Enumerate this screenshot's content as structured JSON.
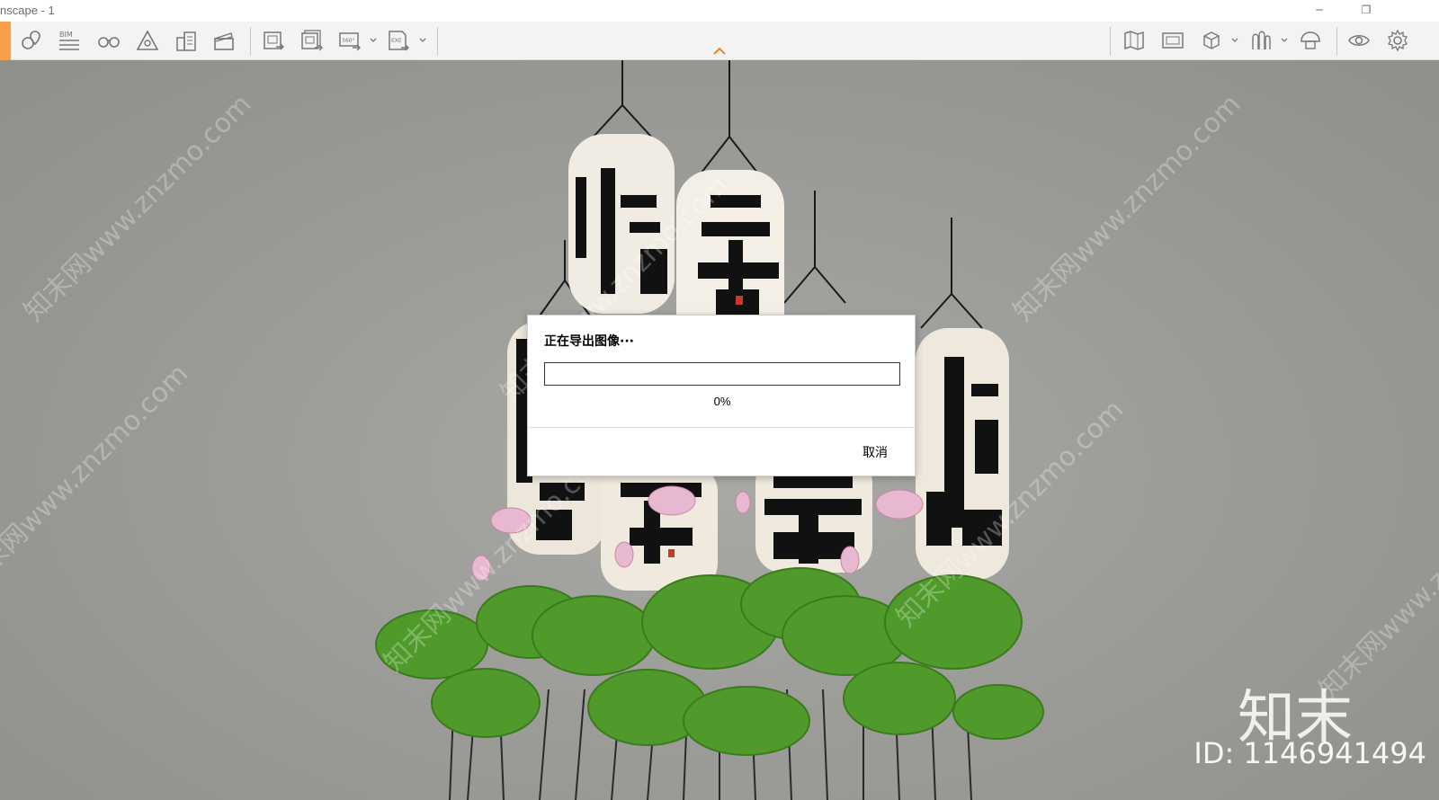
{
  "window": {
    "title": "nscape - 1",
    "minimize_glyph": "─",
    "restore_glyph": "❐"
  },
  "toolbar": {
    "left_icons": [
      "pin-location-icon",
      "bim-list-icon",
      "binoculars-icon",
      "perspective-icon",
      "buildings-icon",
      "clapperboard-icon",
      "export-image-icon",
      "export-batch-image-icon",
      "export-360-icon",
      "export-exe-icon"
    ],
    "right_icons": [
      "map-icon",
      "image-panel-icon",
      "cube-icon",
      "trees-icon",
      "helmet-icon",
      "eye-icon",
      "settings-icon"
    ],
    "bim_label": "BIM",
    "label_360": "360°",
    "label_exe": "EXE",
    "collapse_icon": "chevron-up-icon",
    "accent_color": "#f5821f"
  },
  "watermark": {
    "text": "知末网www.znzmo.com",
    "logo": "知末",
    "id_label": "ID: 1146941494"
  },
  "dialog": {
    "title": "正在导出图像···",
    "progress_percent": 0,
    "progress_label": "0%",
    "cancel_label": "取消"
  }
}
